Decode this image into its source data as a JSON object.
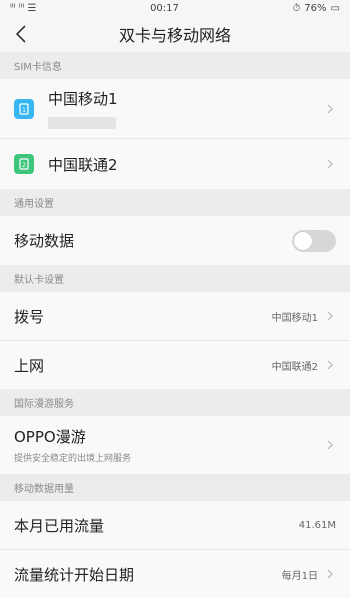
{
  "status_bar": {
    "left_text": "ᴵᴵᴵ ᴵᴵᴵ ☰",
    "time": "00:17",
    "battery": "76%"
  },
  "header": {
    "title": "双卡与移动网络"
  },
  "sections": {
    "sim_info": "SIM卡信息",
    "general": "通用设置",
    "default_card": "默认卡设置",
    "intl_roaming": "国际漫游服务",
    "data_usage": "移动数据用量"
  },
  "sim_cards": [
    {
      "name": "中国移动1",
      "color": "#38b6f0",
      "icon": "sim-card-icon"
    },
    {
      "name": "中国联通2",
      "color": "#3ec67a",
      "icon": "sim-card-icon"
    }
  ],
  "general": {
    "mobile_data_label": "移动数据",
    "mobile_data_on": false
  },
  "default_card": {
    "dial_label": "拨号",
    "dial_value": "中国移动1",
    "internet_label": "上网",
    "internet_value": "中国联通2"
  },
  "roaming": {
    "title": "OPPO漫游",
    "subtitle": "提供安全稳定的出境上网服务"
  },
  "usage": {
    "month_label": "本月已用流量",
    "month_value": "41.61M",
    "start_label": "流量统计开始日期",
    "start_value": "每月1日"
  }
}
